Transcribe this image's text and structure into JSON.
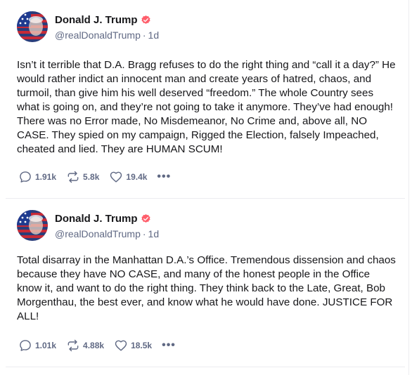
{
  "colors": {
    "accent": "#ff5e6b",
    "muted": "#606984",
    "text": "#17171a",
    "border": "#ececf0"
  },
  "posts": [
    {
      "author": {
        "name": "Donald J. Trump",
        "handle": "@realDonaldTrump",
        "age": "1d",
        "verified_icon": "verified-badge-icon"
      },
      "body": "Isn’t it terrible that D.A. Bragg refuses to do the right thing and “call it a day?” He would rather indict an innocent man and create years of hatred, chaos, and turmoil, than give him his well deserved “freedom.” The whole Country sees what is going on, and they’re not going to take it anymore. They’ve had enough! There was no Error made, No Misdemeanor, No Crime and, above all, NO CASE. They spied on my campaign, Rigged the Election, falsely Impeached, cheated and lied. They are HUMAN SCUM!",
      "stats": {
        "replies": "1.91k",
        "retruths": "5.8k",
        "likes": "19.4k"
      },
      "more_label": "•••"
    },
    {
      "author": {
        "name": "Donald J. Trump",
        "handle": "@realDonaldTrump",
        "age": "1d",
        "verified_icon": "verified-badge-icon"
      },
      "body": "Total disarray in the Manhattan D.A.’s Office. Tremendous dissension and chaos because they have NO CASE, and many of the honest people in the Office know it, and want to do the right thing. They think back to the Late, Great, Bob Morgenthau, the best ever, and know what he would have done. JUSTICE FOR ALL!",
      "stats": {
        "replies": "1.01k",
        "retruths": "4.88k",
        "likes": "18.5k"
      },
      "more_label": "•••"
    }
  ]
}
